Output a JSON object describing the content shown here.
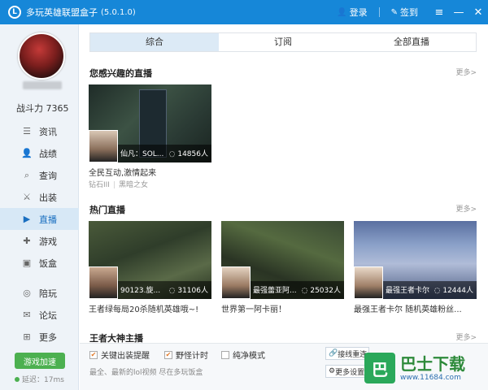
{
  "titlebar": {
    "logo": "L",
    "title": "多玩英雄联盟盒子",
    "version": "(5.0.1.0)",
    "login": "登录",
    "signin": "签到",
    "menu_icon": "≡",
    "min_icon": "—",
    "close_icon": "✕"
  },
  "sidebar": {
    "power": "战斗力 7365",
    "items": [
      {
        "label": "资讯",
        "icon": "news-icon"
      },
      {
        "label": "战绩",
        "icon": "user-icon"
      },
      {
        "label": "查询",
        "icon": "search-icon"
      },
      {
        "label": "出装",
        "icon": "equip-icon"
      },
      {
        "label": "直播",
        "icon": "play-icon",
        "active": true
      },
      {
        "label": "游戏",
        "icon": "gamepad-icon"
      },
      {
        "label": "饭盒",
        "icon": "box-icon"
      }
    ],
    "items2": [
      {
        "label": "陪玩",
        "icon": "companion-icon"
      },
      {
        "label": "论坛",
        "icon": "forum-icon"
      },
      {
        "label": "更多",
        "icon": "grid-icon"
      }
    ],
    "boost": "游戏加速",
    "latency": "延迟：17ms"
  },
  "tabs": [
    {
      "label": "综合",
      "active": true
    },
    {
      "label": "订阅"
    },
    {
      "label": "全部直播"
    }
  ],
  "sections": {
    "interest": {
      "title": "您感兴趣的直播",
      "more": "更多>"
    },
    "hot": {
      "title": "热门直播",
      "more": "更多>"
    },
    "king": {
      "title": "王者大神主播",
      "more": "更多>"
    }
  },
  "interest_card": {
    "name": "仙凡：SOL...",
    "viewers": "14856人",
    "caption": "全民互动,激情起来",
    "rank": "钻石III",
    "hero": "黑暗之女"
  },
  "hot_cards": [
    {
      "name": "90123.旋...",
      "viewers": "31106人",
      "caption": "王者绿每局20杀随机英雄哦~!"
    },
    {
      "name": "最强蕾亚阿...",
      "viewers": "25032人",
      "caption": "世界第一阿卡丽！"
    },
    {
      "name": "最强王者卡尔",
      "viewers": "12444人",
      "caption": "最强王者卡尔 随机英雄粉丝..."
    }
  ],
  "bottom": {
    "opt1": "关键出装提醒",
    "opt2": "野怪计时",
    "opt3": "纯净模式",
    "tip": "最全、最新的lol视频 尽在多玩饭盒",
    "btn1": "接线重连",
    "btn2": "更多设置"
  },
  "watermark": {
    "logo": "巴",
    "text": "巴士下载",
    "url": "www.11684.com"
  }
}
